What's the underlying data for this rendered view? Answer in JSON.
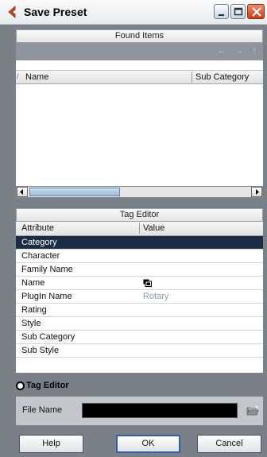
{
  "window": {
    "title": "Save Preset"
  },
  "found_items": {
    "header": "Found Items",
    "nav_arrows": "← → ↑",
    "columns": {
      "name": "Name",
      "sub_category": "Sub Category",
      "sort_mark": "/"
    },
    "rows": []
  },
  "tag_editor": {
    "header": "Tag Editor",
    "columns": {
      "attribute": "Attribute",
      "value": "Value"
    },
    "rows": [
      {
        "attribute": "Category",
        "value": ""
      },
      {
        "attribute": "Character",
        "value": ""
      },
      {
        "attribute": "Family Name",
        "value": ""
      },
      {
        "attribute": "Name",
        "value": ""
      },
      {
        "attribute": "PlugIn Name",
        "value": "Rotary"
      },
      {
        "attribute": "Rating",
        "value": ""
      },
      {
        "attribute": "Style",
        "value": ""
      },
      {
        "attribute": "Sub Category",
        "value": ""
      },
      {
        "attribute": "Sub Style",
        "value": ""
      }
    ],
    "selected_row": "Category"
  },
  "bottom": {
    "tag_editor_toggle": "Tag Editor",
    "file_name_label": "File Name",
    "file_name_value": ""
  },
  "buttons": {
    "help": "Help",
    "ok": "OK",
    "cancel": "Cancel"
  },
  "colors": {
    "accent_icon": "#d2441a",
    "selection": "#1a2d45",
    "panel_bg": "#7a8088",
    "nav_bar": "#8e949b"
  }
}
